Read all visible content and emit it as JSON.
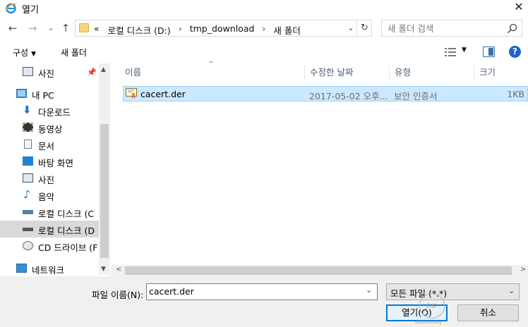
{
  "window": {
    "title": "열기",
    "close": "✕"
  },
  "nav": {
    "back": "←",
    "forward": "→",
    "recent": "⌄",
    "up": "↑"
  },
  "address": {
    "overflow": "«",
    "crumbs": [
      "로컬 디스크 (D:)",
      "tmp_download",
      "새 폴더"
    ],
    "separator": "›",
    "dropdown": "⌄",
    "refresh": "↻"
  },
  "search": {
    "placeholder": "새 폴더 검색",
    "value": ""
  },
  "toolbar": {
    "organize": "구성",
    "organize_arrow": "▼",
    "new_folder": "새 폴더",
    "view_arrow": "▼",
    "help": "?"
  },
  "sidebar": {
    "items": [
      {
        "label": "사진",
        "icon": "pictures-icon"
      },
      {
        "label": "내 PC",
        "icon": "computer-icon"
      },
      {
        "label": "다운로드",
        "icon": "downloads-icon"
      },
      {
        "label": "동영상",
        "icon": "videos-icon"
      },
      {
        "label": "문서",
        "icon": "documents-icon"
      },
      {
        "label": "바탕 화면",
        "icon": "desktop-icon"
      },
      {
        "label": "사진",
        "icon": "pictures-icon"
      },
      {
        "label": "음악",
        "icon": "music-icon"
      },
      {
        "label": "로컬 디스크 (C",
        "icon": "windows-drive-icon"
      },
      {
        "label": "로컬 디스크 (D",
        "icon": "drive-icon"
      },
      {
        "label": "CD 드라이브 (F",
        "icon": "cd-drive-icon"
      },
      {
        "label": "네트워크",
        "icon": "network-icon"
      }
    ],
    "selected_index": 9,
    "pin": "📌",
    "scroll_up": "▲",
    "scroll_down": "▼"
  },
  "file_list": {
    "columns": [
      "이름",
      "수정한 날짜",
      "유형",
      "크기"
    ],
    "sort_arrow": "^",
    "rows": [
      {
        "name": "cacert.der",
        "modified": "2017-05-02 오후...",
        "type": "보안 인증서",
        "size": "1KB",
        "icon": "certificate-icon"
      }
    ],
    "scroll_left": "<",
    "scroll_right": ">"
  },
  "bottom": {
    "filename_label": "파일 이름(N):",
    "filename_value": "cacert.der",
    "filename_dropdown": "⌄",
    "filetype": "모든 파일 (*.*)",
    "filetype_dropdown": "⌄",
    "open": "열기(O)",
    "cancel": "취소"
  },
  "watermark": {
    "glyph": "Jap",
    "text": "dozomonkey"
  },
  "colors": {
    "accent": "#0078d7",
    "selection": "#cce8ff",
    "header_text": "#4c607a",
    "nav_selected": "#d9d9d9"
  }
}
